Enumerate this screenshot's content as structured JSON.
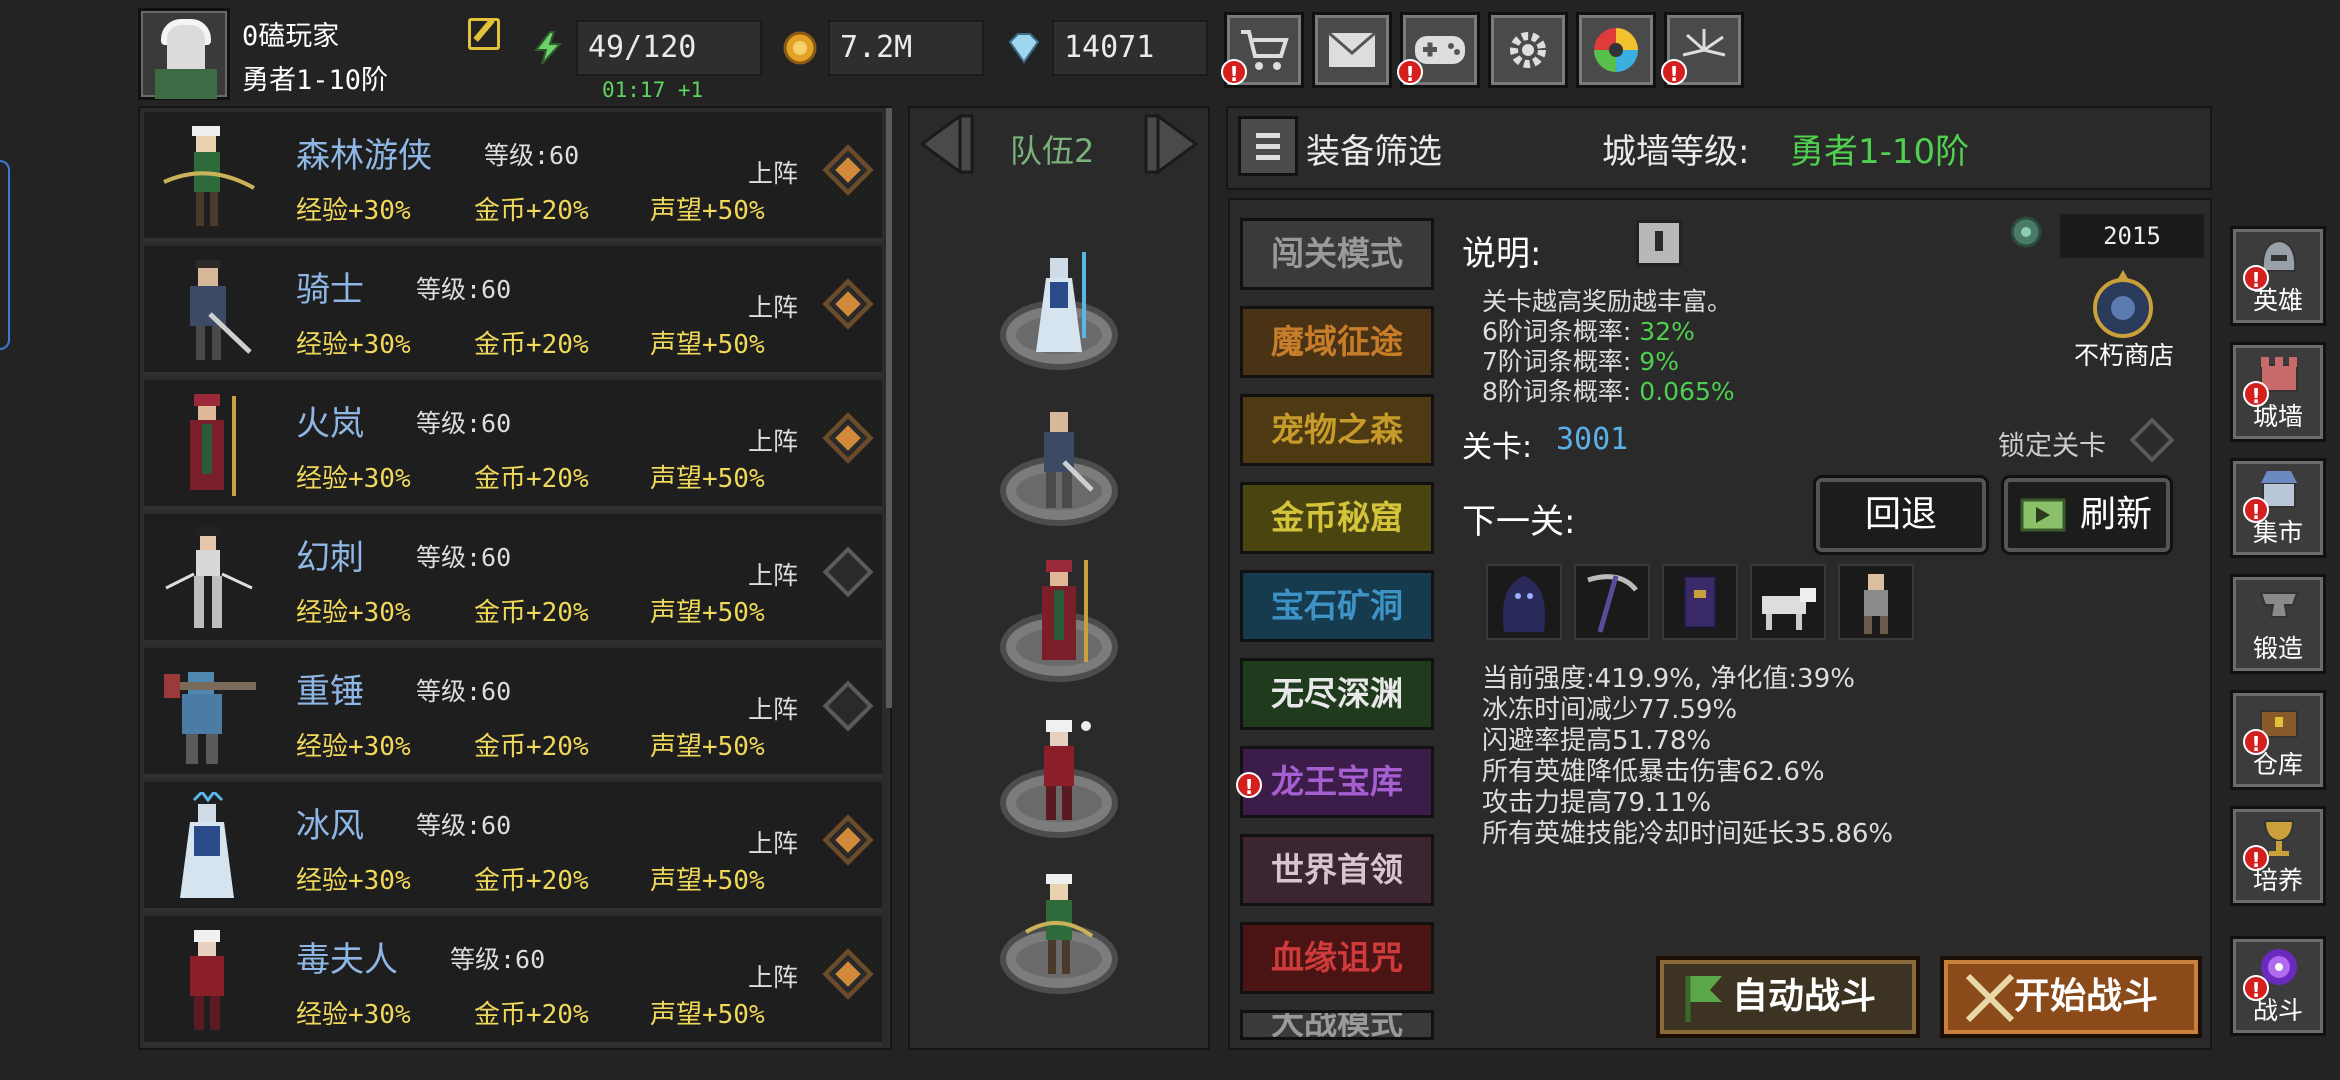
{
  "player": {
    "name": "0磕玩家",
    "rank": "勇者1-10阶"
  },
  "resources": {
    "energy": "49/120",
    "energy_timer": "01:17 +1",
    "gold": "7.2M",
    "diamond": "14071"
  },
  "toolbar": {
    "icons": [
      "cart-icon",
      "mail-icon",
      "gamepad-icon",
      "gear-icon",
      "aperture-icon",
      "firework-icon"
    ]
  },
  "heroes": [
    {
      "name": "森林游侠",
      "level": "等级:60",
      "exp": "经验+30%",
      "gold": "金币+20%",
      "fame": "声望+50%",
      "deploy": "上阵",
      "active": true
    },
    {
      "name": "骑士",
      "level": "等级:60",
      "exp": "经验+30%",
      "gold": "金币+20%",
      "fame": "声望+50%",
      "deploy": "上阵",
      "active": true
    },
    {
      "name": "火岚",
      "level": "等级:60",
      "exp": "经验+30%",
      "gold": "金币+20%",
      "fame": "声望+50%",
      "deploy": "上阵",
      "active": true
    },
    {
      "name": "幻刺",
      "level": "等级:60",
      "exp": "经验+30%",
      "gold": "金币+20%",
      "fame": "声望+50%",
      "deploy": "上阵",
      "active": false
    },
    {
      "name": "重锤",
      "level": "等级:60",
      "exp": "经验+30%",
      "gold": "金币+20%",
      "fame": "声望+50%",
      "deploy": "上阵",
      "active": false
    },
    {
      "name": "冰风",
      "level": "等级:60",
      "exp": "经验+30%",
      "gold": "金币+20%",
      "fame": "声望+50%",
      "deploy": "上阵",
      "active": true
    },
    {
      "name": "毒夫人",
      "level": "等级:60",
      "exp": "经验+30%",
      "gold": "金币+20%",
      "fame": "声望+50%",
      "deploy": "上阵",
      "active": true
    }
  ],
  "team": {
    "label": "队伍2"
  },
  "filter": {
    "label": "装备筛选"
  },
  "wall": {
    "label": "城墙等级:",
    "value": "勇者1-10阶"
  },
  "modes": [
    {
      "label": "闯关模式",
      "bg": "#3a3a3a",
      "fg": "#9a9a9a"
    },
    {
      "label": "魔域征途",
      "bg": "#4a3315",
      "fg": "#c77d2a"
    },
    {
      "label": "宠物之森",
      "bg": "#4d3a12",
      "fg": "#c79b2a"
    },
    {
      "label": "金币秘窟",
      "bg": "#4a4510",
      "fg": "#d4c43a"
    },
    {
      "label": "宝石矿洞",
      "bg": "#163b4f",
      "fg": "#3e93c6"
    },
    {
      "label": "无尽深渊",
      "bg": "#1f3a1c",
      "fg": "#e8e8e8"
    },
    {
      "label": "龙王宝库",
      "bg": "#3c1d4a",
      "fg": "#a65fd0"
    },
    {
      "label": "世界首领",
      "bg": "#3b2530",
      "fg": "#d8c3cf"
    },
    {
      "label": "血缘诅咒",
      "bg": "#4a1414",
      "fg": "#cf3a3a"
    },
    {
      "label": "大战模式",
      "bg": "#3a3a3a",
      "fg": "#9a9a9a"
    }
  ],
  "details": {
    "title": "说明:",
    "desc": "关卡越高奖励越丰富。",
    "rates": [
      {
        "label": "6阶词条概率:",
        "value": "32%"
      },
      {
        "label": "7阶词条概率:",
        "value": "9%"
      },
      {
        "label": "8阶词条概率:",
        "value": "0.065%"
      }
    ],
    "stage_label": "关卡:",
    "stage_value": "3001",
    "lock_label": "锁定关卡",
    "coin_count": "2015",
    "shop_label": "不朽商店",
    "next_label": "下一关:",
    "back_btn": "回退",
    "refresh_btn": "刷新",
    "stats": [
      "当前强度:419.9%, 净化值:39%",
      "冰冻时间减少77.59%",
      "闪避率提高51.78%",
      "所有英雄降低暴击伤害62.6%",
      "攻击力提高79.11%",
      "所有英雄技能冷却时间延长35.86%"
    ],
    "auto_btn": "自动战斗",
    "start_btn": "开始战斗"
  },
  "sidenav": [
    "英雄",
    "城墙",
    "集市",
    "锻造",
    "仓库",
    "培养",
    "战斗"
  ]
}
